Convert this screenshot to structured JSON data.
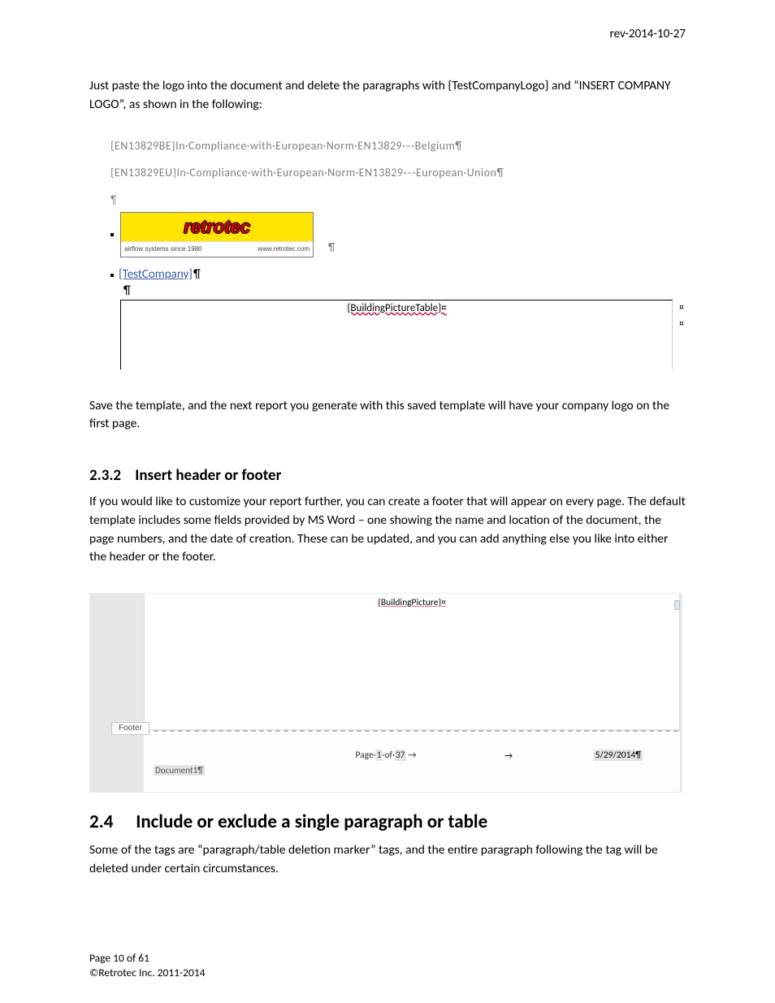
{
  "header": {
    "revision": "rev-2014-10-27"
  },
  "intro": {
    "line": "Just paste the logo into the document and delete the paragraphs with {TestCompanyLogo} and “INSERT COMPANY LOGO”, as shown in the following:"
  },
  "fig1": {
    "line1": "{EN13829BE}In·Compliance·with·European·Norm·EN13829·–·Belgium¶",
    "line2": "{EN13829EU}In·Compliance·with·European·Norm·EN13829·–·European·Union¶",
    "lonePil": "¶",
    "logo": {
      "brand": "retrotec",
      "tagline_left": "airflow systems since 1980",
      "tagline_right": "www.retrotec.com"
    },
    "afterLogoPil": "¶",
    "testCompany": "{TestCompany}",
    "tcPil": "¶",
    "lonePil2": "¶",
    "buildingPicTag": "{BuildingPictureTable}¤",
    "cellMark": "¤"
  },
  "afterFig1": {
    "line": "Save the template, and the next report you generate with this saved template will have your company logo on the first page."
  },
  "h232": {
    "num": "2.3.2",
    "title": "Insert header or footer",
    "body": "If you would like to customize your report further, you can create a footer that will appear on every page.  The default template includes some fields provided by MS Word – one showing the name and location of the document, the page numbers, and the date of creation.  These can be updated, and you can add anything else you like into either the header or the footer."
  },
  "fig2": {
    "buildingPic": "{BuildingPicture}¤",
    "footerTab": "Footer",
    "doc1": "Document1¶",
    "pagePrefix": "Page·",
    "pageCur": "1",
    "pageMid": "·of·",
    "pageTot": "37",
    "pageArrow": "→",
    "arrow2": "→",
    "date": "5/29/2014¶"
  },
  "h24": {
    "num": "2.4",
    "title": "Include or exclude a single paragraph or table",
    "body": "Some of the tags are “paragraph/table deletion marker” tags, and the entire paragraph following the tag will be deleted under certain circumstances."
  },
  "footer": {
    "pageline": "Page 10 of 61",
    "copyright": "©Retrotec Inc. 2011-2014"
  }
}
